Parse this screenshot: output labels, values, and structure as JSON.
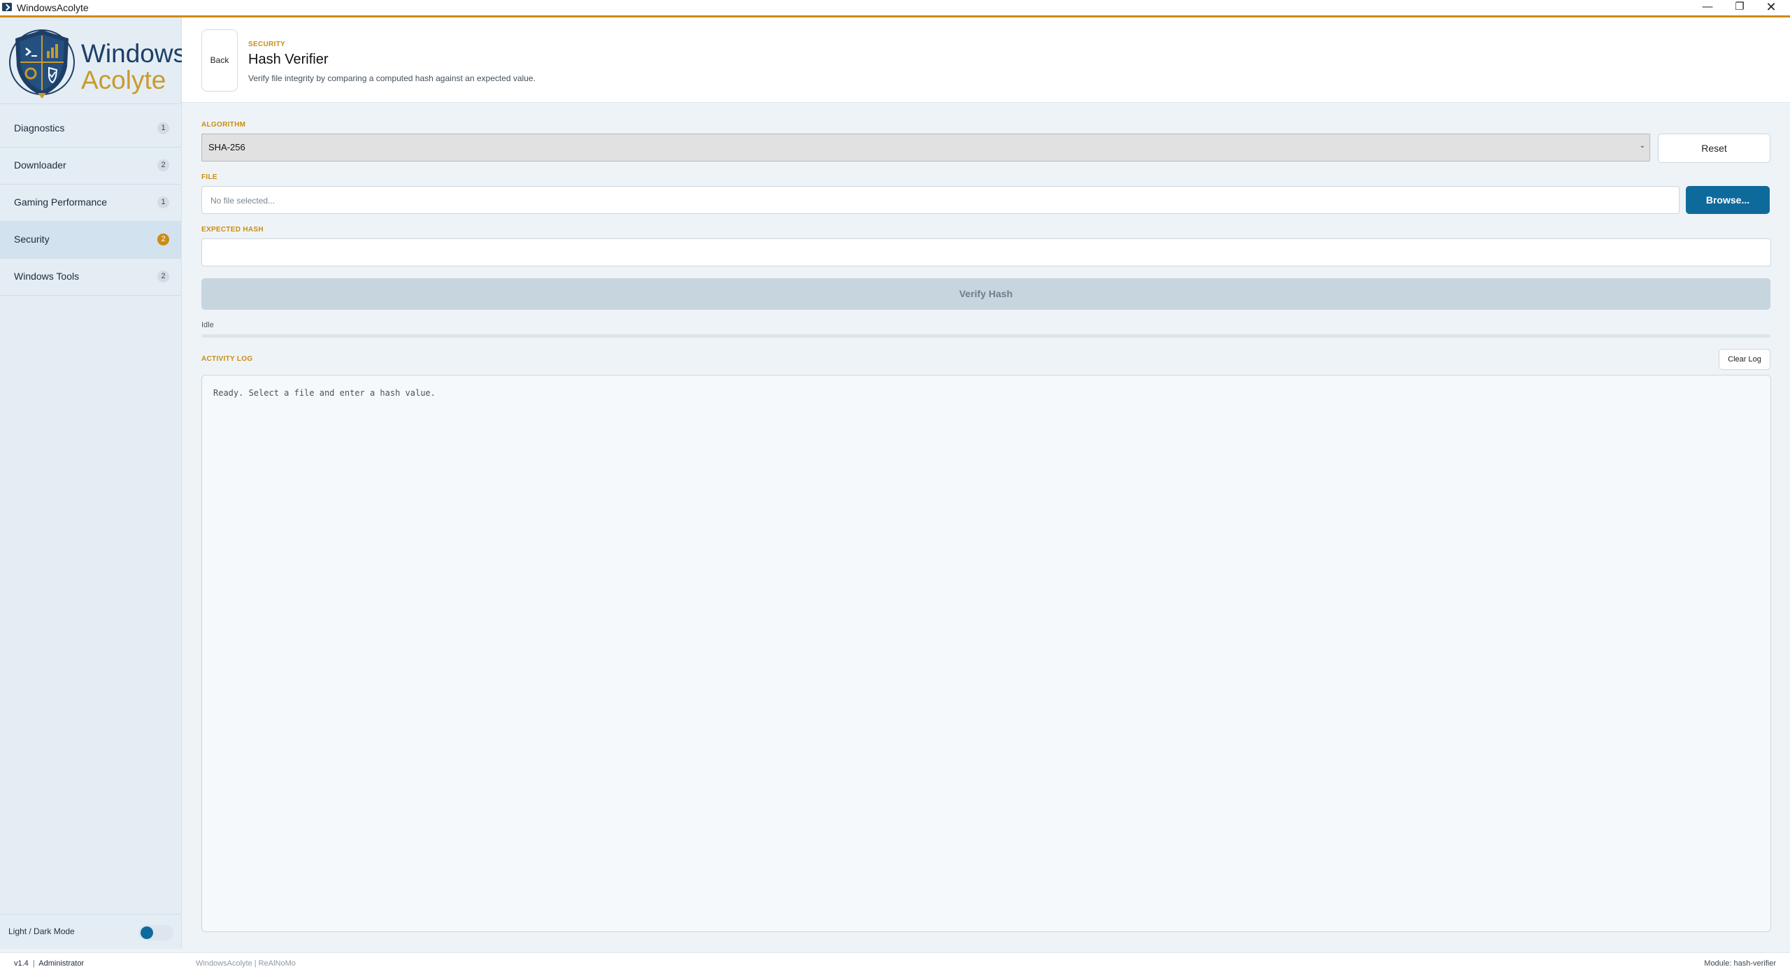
{
  "window": {
    "title": "WindowsAcolyte",
    "minimize": "—",
    "maximize": "❐",
    "close": "✕"
  },
  "logo": {
    "line1": "Windows",
    "line2": "Acolyte"
  },
  "sidebar": {
    "items": [
      {
        "label": "Diagnostics",
        "count": "1"
      },
      {
        "label": "Downloader",
        "count": "2"
      },
      {
        "label": "Gaming Performance",
        "count": "1"
      },
      {
        "label": "Security",
        "count": "2",
        "active": true
      },
      {
        "label": "Windows Tools",
        "count": "2"
      }
    ],
    "theme_label": "Light / Dark Mode"
  },
  "header": {
    "back": "Back",
    "breadcrumb": "SECURITY",
    "title": "Hash Verifier",
    "subtitle": "Verify file integrity by comparing a computed hash against an expected value."
  },
  "form": {
    "algorithm_label": "ALGORITHM",
    "algorithm_value": "SHA-256",
    "reset": "Reset",
    "file_label": "FILE",
    "file_placeholder": "No file selected...",
    "browse": "Browse...",
    "expected_label": "EXPECTED HASH",
    "expected_value": "",
    "verify": "Verify Hash",
    "status": "Idle",
    "progress": 0
  },
  "log": {
    "label": "ACTIVITY LOG",
    "clear": "Clear Log",
    "lines": [
      "Ready. Select a file and enter a hash value."
    ]
  },
  "footer": {
    "version": "v1.4",
    "sep": "|",
    "role": "Administrator",
    "app": "WindowsAcolyte  |  ReAlNoMo",
    "module": "Module: hash-verifier"
  },
  "colors": {
    "accent": "#c98d14",
    "primary": "#0f6a9c",
    "navy": "#1d3e66"
  }
}
